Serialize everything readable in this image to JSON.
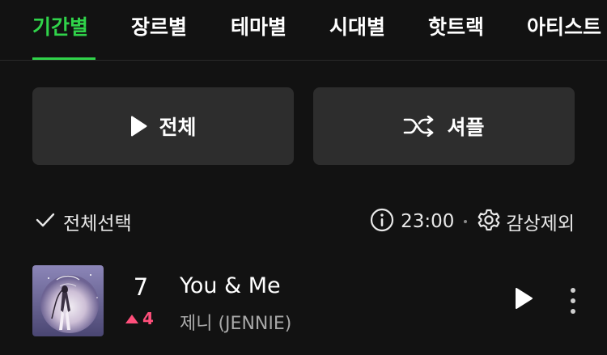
{
  "tabs": [
    {
      "label": "기간별",
      "active": true
    },
    {
      "label": "장르별",
      "active": false
    },
    {
      "label": "테마별",
      "active": false
    },
    {
      "label": "시대별",
      "active": false
    },
    {
      "label": "핫트랙",
      "active": false
    },
    {
      "label": "아티스트",
      "active": false
    }
  ],
  "actions": {
    "play_all_label": "전체",
    "shuffle_label": "셔플"
  },
  "toolbar": {
    "select_all_label": "전체선택",
    "time_label": "23:00",
    "exclude_label": "감상제외"
  },
  "songs": [
    {
      "rank": "7",
      "change": "4",
      "change_direction": "up",
      "title": "You & Me",
      "artist": "제니 (JENNIE)"
    }
  ],
  "colors": {
    "accent": "#30d34a",
    "rank_up": "#ff4f7b",
    "background": "#121212",
    "button_bg": "#2d2d2d"
  },
  "icons": {
    "play": "play-icon",
    "shuffle": "shuffle-icon",
    "check": "check-icon",
    "info": "info-icon",
    "gear": "gear-icon",
    "more": "more-vertical-icon"
  }
}
